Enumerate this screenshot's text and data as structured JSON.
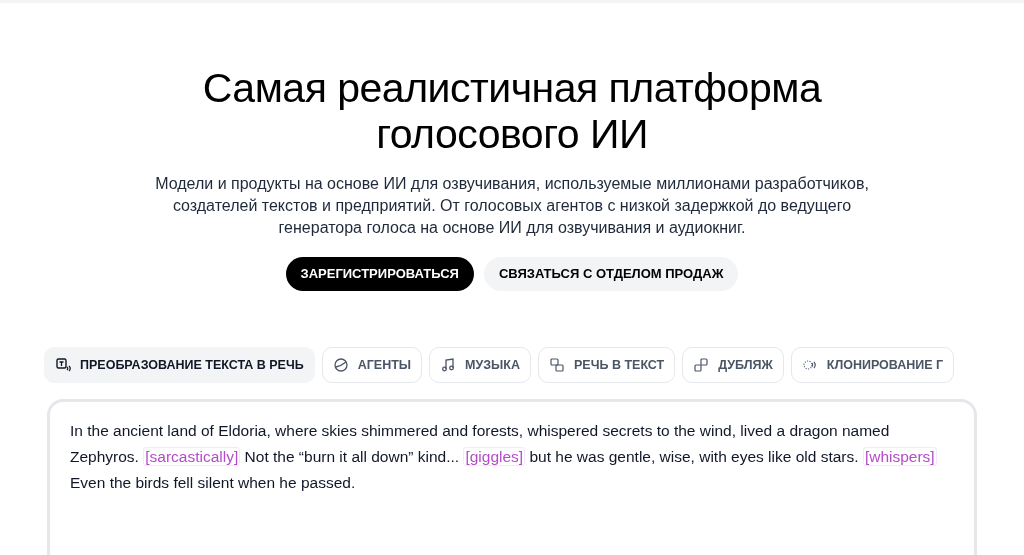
{
  "hero": {
    "title": "Самая реалистичная платформа голосового ИИ",
    "subtitle": "Модели и продукты на основе ИИ для озвучивания, используемые миллионами разработчиков, создателей текстов и предприятий. От голосовых агентов с низкой задержкой до ведущего генератора голоса на основе ИИ для озвучивания и аудиокниг."
  },
  "buttons": [
    {
      "label": "ЗАРЕГИСТРИРОВАТЬСЯ",
      "kind": "primary"
    },
    {
      "label": "СВЯЗАТЬСЯ С ОТДЕЛОМ ПРОДАЖ",
      "kind": "secondary"
    }
  ],
  "tabs": [
    {
      "label": "ПРЕОБРАЗОВАНИЕ ТЕКСТА В РЕЧЬ",
      "selected": true
    },
    {
      "label": "АГЕНТЫ",
      "selected": false
    },
    {
      "label": "МУЗЫКА",
      "selected": false
    },
    {
      "label": "РЕЧЬ В ТЕКСТ",
      "selected": false
    },
    {
      "label": "ДУБЛЯЖ",
      "selected": false
    },
    {
      "label": "КЛОНИРОВАНИЕ Г",
      "selected": false
    }
  ],
  "editor": {
    "segments": [
      {
        "kind": "text",
        "text": "In the ancient land of Eldoria, where skies shimmered and forests, whispered secrets to the wind, lived a dragon named Zephyros."
      },
      {
        "kind": "tag",
        "text": "[sarcastically]"
      },
      {
        "kind": "text",
        "text": "Not the “burn it all down” kind..."
      },
      {
        "kind": "tag",
        "text": "[giggles]"
      },
      {
        "kind": "text",
        "text": "but he was gentle, wise, with eyes like old stars."
      },
      {
        "kind": "tag",
        "text": "[whispers]"
      },
      {
        "kind": "text",
        "text": "Even the birds fell silent when he passed."
      }
    ]
  }
}
